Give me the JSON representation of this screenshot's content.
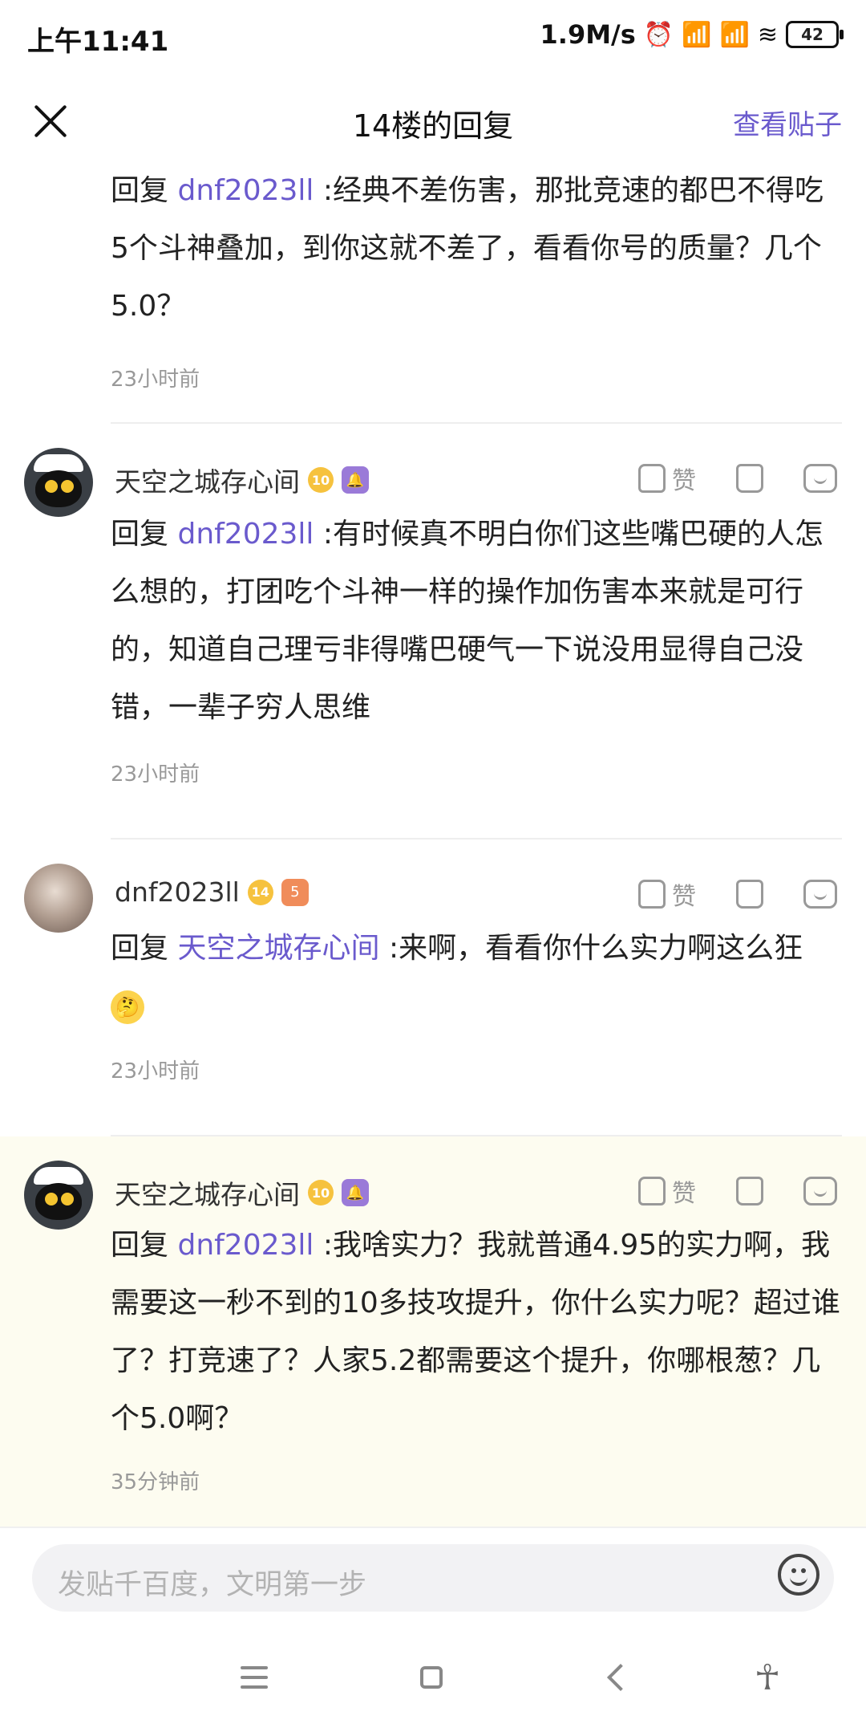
{
  "status_bar": {
    "time": "上午11:41",
    "network_speed": "1.9M/s",
    "battery": "42",
    "icons": [
      "alarm-icon",
      "hd-signal-icon",
      "hd-signal-icon",
      "wifi-icon",
      "battery-icon"
    ]
  },
  "header": {
    "title": "14楼的回复",
    "view_post_label": "查看贴子"
  },
  "replies": [
    {
      "reply_prefix": "回复",
      "mention": "dnf2023ll",
      "text": ":经典不差伤害，那批竞速的都巴不得吃5个斗神叠加，到你这就不差了，看看你号的质量？几个5.0？",
      "time": "23小时前"
    },
    {
      "username": "天空之城存心间",
      "level": "10",
      "like_label": "赞",
      "reply_prefix": "回复",
      "mention": "dnf2023ll",
      "text": ":有时候真不明白你们这些嘴巴硬的人怎么想的，打团吃个斗神一样的操作加伤害本来就是可行的，知道自己理亏非得嘴巴硬气一下说没用显得自己没错，一辈子穷人思维",
      "time": "23小时前"
    },
    {
      "username": "dnf2023ll",
      "level": "14",
      "rank_badge": "5",
      "like_label": "赞",
      "reply_prefix": "回复",
      "mention": "天空之城存心间",
      "text": ":来啊，看看你什么实力啊这么狂",
      "time": "23小时前"
    },
    {
      "username": "天空之城存心间",
      "level": "10",
      "like_label": "赞",
      "reply_prefix": "回复",
      "mention": "dnf2023ll",
      "text": ":我啥实力？我就普通4.95的实力啊，我需要这一秒不到的10多技攻提升，你什么实力呢？超过谁了？打竞速了？人家5.2都需要这个提升，你哪根葱？几个5.0啊？",
      "time": "35分钟前"
    }
  ],
  "input": {
    "placeholder": "发贴千百度，文明第一步"
  },
  "colors": {
    "accent": "#6a5acd",
    "highlight_bg": "#fdfcf0",
    "muted": "#999999"
  }
}
